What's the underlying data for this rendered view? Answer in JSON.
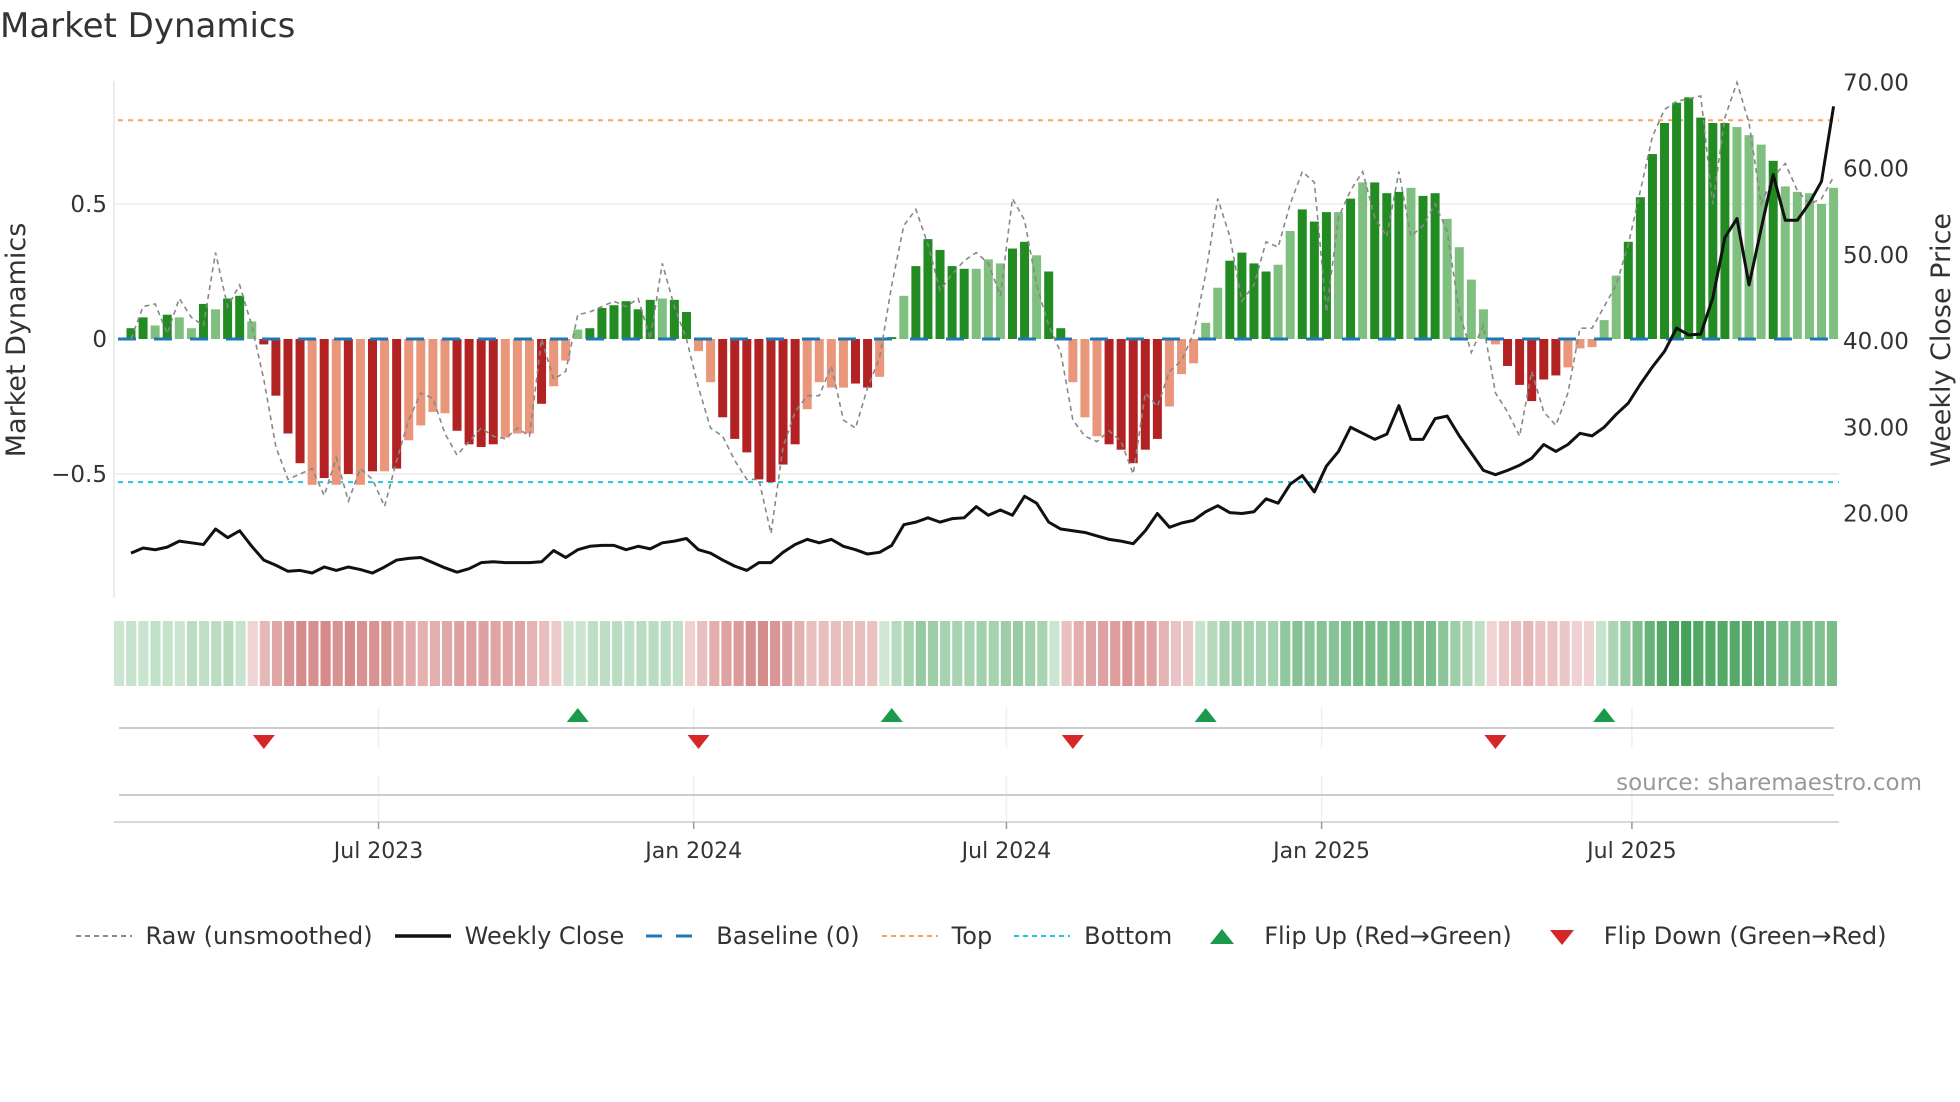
{
  "title": "Market Dynamics",
  "source": "source: sharemaestro.com",
  "chart_data": {
    "type": "bar",
    "title": "Market Dynamics",
    "ylabel": "Market Dynamics",
    "y2label": "Weekly Close Price",
    "ylim": [
      -0.97,
      0.95
    ],
    "y2lim": [
      10,
      72
    ],
    "yticks": [
      {
        "v": 0.5,
        "label": "0.5"
      },
      {
        "v": 0,
        "label": "0"
      },
      {
        "v": -0.5,
        "label": "−0.5"
      }
    ],
    "y2ticks": [
      {
        "v": 70,
        "label": "70.00"
      },
      {
        "v": 60,
        "label": "60.00"
      },
      {
        "v": 50,
        "label": "50.00"
      },
      {
        "v": 40,
        "label": "40.00"
      },
      {
        "v": 30,
        "label": "30.00"
      },
      {
        "v": 20,
        "label": "20.00"
      }
    ],
    "xticks": [
      {
        "week": 20.5,
        "label": "Jul 2023"
      },
      {
        "week": 46.6,
        "label": "Jan 2024"
      },
      {
        "week": 72.5,
        "label": "Jul 2024"
      },
      {
        "week": 98.6,
        "label": "Jan 2025"
      },
      {
        "week": 124.3,
        "label": "Jul 2025"
      }
    ],
    "top": 0.81,
    "bottom": -0.53,
    "baseline": 0,
    "smoothed": [
      0.04,
      0.08,
      0.05,
      0.09,
      0.08,
      0.04,
      0.13,
      0.11,
      0.15,
      0.16,
      0.065,
      -0.02,
      -0.21,
      -0.35,
      -0.46,
      -0.54,
      -0.515,
      -0.54,
      -0.5,
      -0.54,
      -0.49,
      -0.49,
      -0.48,
      -0.375,
      -0.32,
      -0.27,
      -0.275,
      -0.34,
      -0.39,
      -0.4,
      -0.39,
      -0.365,
      -0.35,
      -0.35,
      -0.24,
      -0.175,
      -0.08,
      0.035,
      0.04,
      0.115,
      0.125,
      0.14,
      0.11,
      0.145,
      0.15,
      0.145,
      0.1,
      -0.045,
      -0.16,
      -0.29,
      -0.37,
      -0.42,
      -0.52,
      -0.53,
      -0.465,
      -0.39,
      -0.26,
      -0.16,
      -0.18,
      -0.18,
      -0.165,
      -0.18,
      -0.14,
      0.007,
      0.16,
      0.27,
      0.37,
      0.33,
      0.27,
      0.26,
      0.26,
      0.295,
      0.28,
      0.335,
      0.36,
      0.31,
      0.25,
      0.04,
      -0.16,
      -0.29,
      -0.36,
      -0.39,
      -0.41,
      -0.46,
      -0.41,
      -0.37,
      -0.25,
      -0.13,
      -0.09,
      0.06,
      0.19,
      0.29,
      0.32,
      0.28,
      0.25,
      0.275,
      0.4,
      0.48,
      0.435,
      0.47,
      0.47,
      0.52,
      0.58,
      0.58,
      0.54,
      0.545,
      0.56,
      0.53,
      0.54,
      0.445,
      0.34,
      0.22,
      0.11,
      -0.02,
      -0.1,
      -0.17,
      -0.23,
      -0.15,
      -0.135,
      -0.105,
      -0.035,
      -0.03,
      0.07,
      0.235,
      0.36,
      0.525,
      0.685,
      0.8,
      0.875,
      0.895,
      0.82,
      0.8,
      0.8,
      0.785,
      0.755,
      0.72,
      0.66,
      0.565,
      0.545,
      0.54,
      0.5,
      0.56
    ],
    "strong": "ddldlldlddl",
    "strong_red1": "ddddddldldldllllddddllldlll",
    "strong_flags": "ddldlldlddlddddldldldldllllddddllldlllddddddlddlldddddddllllddldldddddlllddlddllldddddlllllddddlldddldldddlddllllldddddllllldddddddddllldllllllllld",
    "raw": [
      0.0,
      0.12,
      0.13,
      0.02,
      0.15,
      0.08,
      0.05,
      0.32,
      0.12,
      0.2,
      0.05,
      -0.15,
      -0.4,
      -0.52,
      -0.5,
      -0.48,
      -0.58,
      -0.44,
      -0.6,
      -0.48,
      -0.52,
      -0.62,
      -0.45,
      -0.3,
      -0.2,
      -0.22,
      -0.35,
      -0.43,
      -0.38,
      -0.33,
      -0.36,
      -0.37,
      -0.33,
      -0.36,
      0.0,
      -0.15,
      -0.12,
      0.09,
      0.1,
      0.12,
      0.14,
      0.12,
      0.15,
      0.0,
      0.28,
      0.12,
      0.0,
      -0.18,
      -0.33,
      -0.36,
      -0.45,
      -0.52,
      -0.52,
      -0.72,
      -0.4,
      -0.27,
      -0.21,
      -0.21,
      -0.1,
      -0.3,
      -0.33,
      -0.18,
      -0.07,
      0.2,
      0.42,
      0.48,
      0.35,
      0.18,
      0.24,
      0.29,
      0.32,
      0.28,
      0.16,
      0.52,
      0.44,
      0.2,
      0.05,
      -0.05,
      -0.3,
      -0.36,
      -0.38,
      -0.34,
      -0.38,
      -0.5,
      -0.2,
      -0.25,
      -0.12,
      -0.08,
      0.02,
      0.24,
      0.52,
      0.38,
      0.14,
      0.2,
      0.36,
      0.34,
      0.5,
      0.62,
      0.58,
      0.1,
      0.45,
      0.55,
      0.62,
      0.45,
      0.38,
      0.62,
      0.38,
      0.42,
      0.5,
      0.4,
      0.1,
      -0.05,
      0.05,
      -0.2,
      -0.27,
      -0.36,
      -0.12,
      -0.27,
      -0.32,
      -0.2,
      0.04,
      0.04,
      0.12,
      0.2,
      0.35,
      0.55,
      0.75,
      0.85,
      0.88,
      0.89,
      0.9,
      0.5,
      0.82,
      0.95,
      0.8,
      0.5,
      0.6,
      0.65,
      0.55,
      0.5,
      0.52,
      0.6
    ],
    "close": [
      15.4,
      16,
      15.8,
      16.1,
      16.8,
      16.6,
      16.4,
      18.2,
      17.2,
      18,
      16.2,
      14.6,
      14,
      13.3,
      13.4,
      13.1,
      13.8,
      13.4,
      13.8,
      13.5,
      13.1,
      13.8,
      14.6,
      14.8,
      14.9,
      14.3,
      13.7,
      13.2,
      13.6,
      14.3,
      14.4,
      14.3,
      14.3,
      14.3,
      14.4,
      15.7,
      14.9,
      15.8,
      16.2,
      16.3,
      16.3,
      15.8,
      16.2,
      15.9,
      16.6,
      16.8,
      17.1,
      15.8,
      15.4,
      14.6,
      13.9,
      13.4,
      14.3,
      14.3,
      15.5,
      16.4,
      17,
      16.6,
      17,
      16.2,
      15.8,
      15.3,
      15.5,
      16.3,
      18.7,
      19,
      19.5,
      19,
      19.4,
      19.5,
      20.8,
      19.8,
      20.4,
      19.8,
      22,
      21.2,
      19,
      18.2,
      18,
      17.8,
      17.4,
      17,
      16.8,
      16.5,
      18,
      20,
      18.4,
      18.9,
      19.2,
      20.2,
      20.9,
      20.1,
      20,
      20.2,
      21.7,
      21.2,
      23.4,
      24.4,
      22.5,
      25.5,
      27.2,
      30,
      29.3,
      28.6,
      29.2,
      32.5,
      28.6,
      28.6,
      31,
      31.3,
      29,
      27,
      25,
      24.5,
      25,
      25.6,
      26.4,
      28,
      27.2,
      28,
      29.3,
      29,
      30,
      31.5,
      32.8,
      35,
      37,
      38.8,
      41.5,
      40.7,
      40.8,
      45,
      52,
      54.2,
      46.5,
      53,
      59.3,
      54,
      54,
      56,
      58.5,
      67.2
    ],
    "flips_up": [
      37,
      63,
      89,
      122
    ],
    "flips_down": [
      11,
      47,
      78,
      113
    ],
    "colors": {
      "green_strong": "#228b22",
      "green_light": "#7fbf7f",
      "red_strong": "#b22222",
      "red_light": "#e9967a",
      "close": "#111111",
      "raw": "#888888",
      "baseline": "#1f77b4",
      "top": "#f4a460",
      "bottom": "#22c4d8",
      "flip_up": "#1a9a4a",
      "flip_down": "#d62728"
    }
  },
  "legend": [
    {
      "key": "raw",
      "label": "Raw (unsmoothed)"
    },
    {
      "key": "close",
      "label": "Weekly Close"
    },
    {
      "key": "baseline",
      "label": "Baseline (0)"
    },
    {
      "key": "top",
      "label": "Top"
    },
    {
      "key": "bottom",
      "label": "Bottom"
    },
    {
      "key": "flip_up",
      "label": "Flip Up (Red→Green)"
    },
    {
      "key": "flip_down",
      "label": "Flip Down (Green→Red)"
    }
  ]
}
